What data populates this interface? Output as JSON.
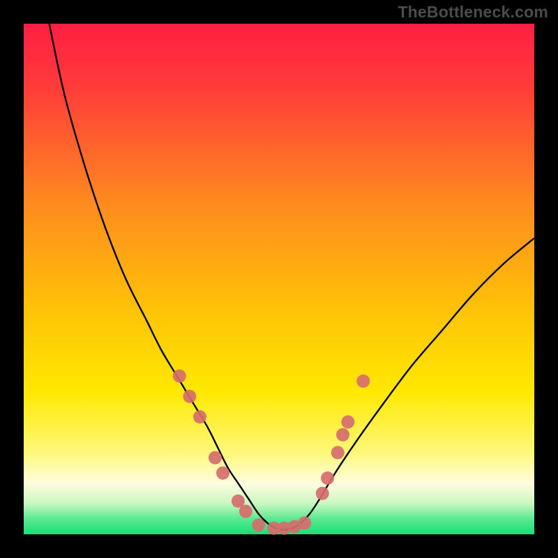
{
  "watermark": "TheBottleneck.com",
  "colors": {
    "frame": "#000000",
    "curve": "#000000",
    "marker": "#d66d6d",
    "gradient_top": "#ff1f42",
    "gradient_mid1": "#ff8a1f",
    "gradient_mid2": "#ffe800",
    "gradient_mid3": "#fff8a0",
    "gradient_bottom": "#18e07a"
  },
  "chart_data": {
    "type": "line",
    "title": "",
    "xlabel": "",
    "ylabel": "",
    "xlim": [
      0,
      100
    ],
    "ylim": [
      0,
      100
    ],
    "series": [
      {
        "name": "curve",
        "x": [
          5,
          8,
          12,
          16,
          20,
          24,
          27,
          30,
          33,
          36,
          38,
          40,
          42,
          44,
          46,
          48,
          50,
          52,
          54,
          56,
          58,
          61,
          65,
          70,
          76,
          82,
          88,
          94,
          100
        ],
        "y": [
          100,
          86,
          72,
          60,
          50,
          42,
          36,
          31,
          26,
          21,
          17,
          13,
          10,
          7,
          4,
          2,
          1,
          1,
          2,
          4,
          7,
          12,
          18,
          25,
          33,
          40,
          47,
          53,
          58
        ]
      }
    ],
    "markers": [
      {
        "x": 30.5,
        "y": 31
      },
      {
        "x": 32.5,
        "y": 27
      },
      {
        "x": 34.5,
        "y": 23
      },
      {
        "x": 37.5,
        "y": 15
      },
      {
        "x": 39.0,
        "y": 12
      },
      {
        "x": 42.0,
        "y": 6.5
      },
      {
        "x": 43.5,
        "y": 4.5
      },
      {
        "x": 46.0,
        "y": 1.8
      },
      {
        "x": 49.0,
        "y": 1.2
      },
      {
        "x": 51.0,
        "y": 1.2
      },
      {
        "x": 53.0,
        "y": 1.5
      },
      {
        "x": 55.0,
        "y": 2.2
      },
      {
        "x": 58.5,
        "y": 8
      },
      {
        "x": 59.5,
        "y": 11
      },
      {
        "x": 61.5,
        "y": 16
      },
      {
        "x": 62.5,
        "y": 19.5
      },
      {
        "x": 63.5,
        "y": 22
      },
      {
        "x": 66.5,
        "y": 30
      }
    ]
  }
}
